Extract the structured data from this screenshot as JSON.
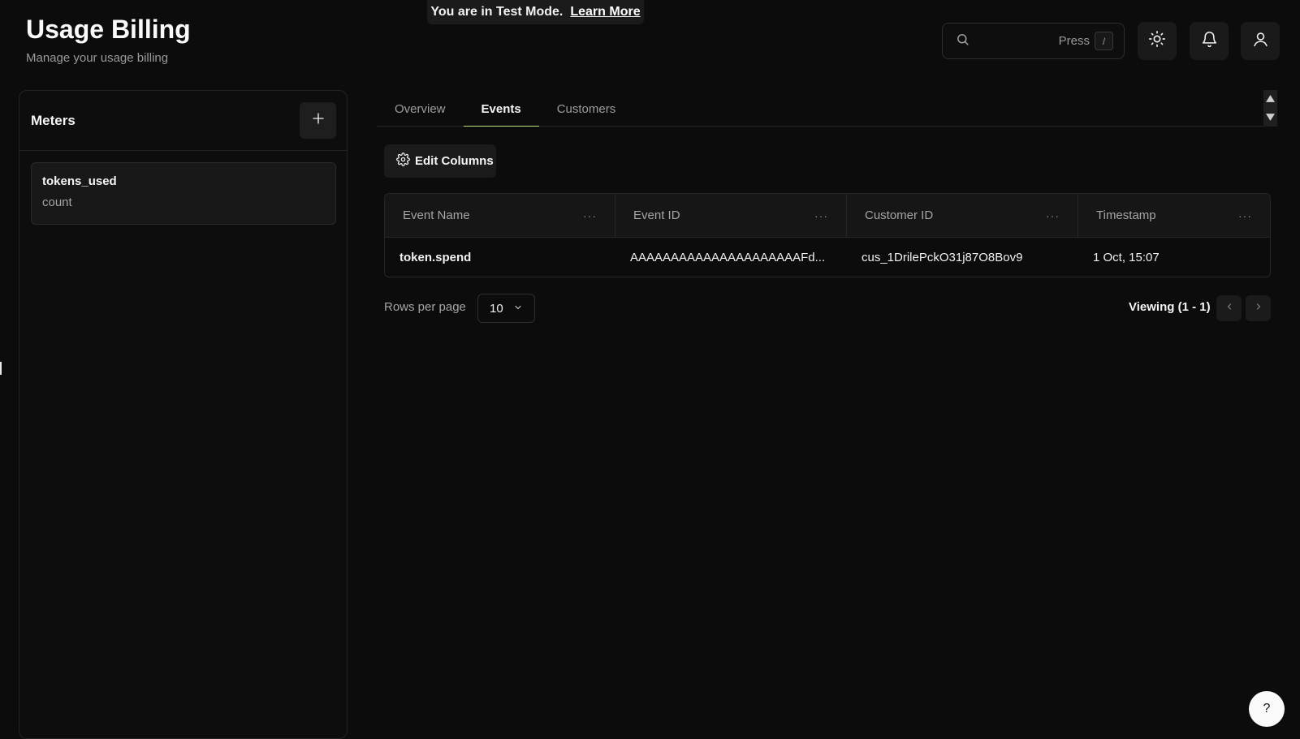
{
  "banner": {
    "text": "You are in Test Mode.",
    "link": "Learn More"
  },
  "header": {
    "title": "Usage Billing",
    "subtitle": "Manage your usage billing",
    "search": {
      "hint": "Press",
      "shortcut": "/"
    }
  },
  "meters": {
    "title": "Meters",
    "items": [
      {
        "name": "tokens_used",
        "aggregation": "count"
      }
    ]
  },
  "tabs": [
    {
      "label": "Overview",
      "active": false
    },
    {
      "label": "Events",
      "active": true
    },
    {
      "label": "Customers",
      "active": false
    }
  ],
  "toolbar": {
    "edit_columns": "Edit Columns"
  },
  "table": {
    "columns": [
      "Event Name",
      "Event ID",
      "Customer ID",
      "Timestamp"
    ],
    "rows": [
      {
        "event_name": "token.spend",
        "event_id": "AAAAAAAAAAAAAAAAAAAAAFd...",
        "customer_id": "cus_1DrilePckO31j87O8Bov9",
        "timestamp": "1 Oct, 15:07"
      }
    ]
  },
  "pagination": {
    "rows_per_page_label": "Rows per page",
    "rows_per_page": "10",
    "viewing": "Viewing (1 - 1)"
  },
  "help": {
    "label": "?"
  },
  "colors": {
    "accent": "#bfe07a",
    "background": "#0c0c0c",
    "panel": "#1b1b1b"
  }
}
